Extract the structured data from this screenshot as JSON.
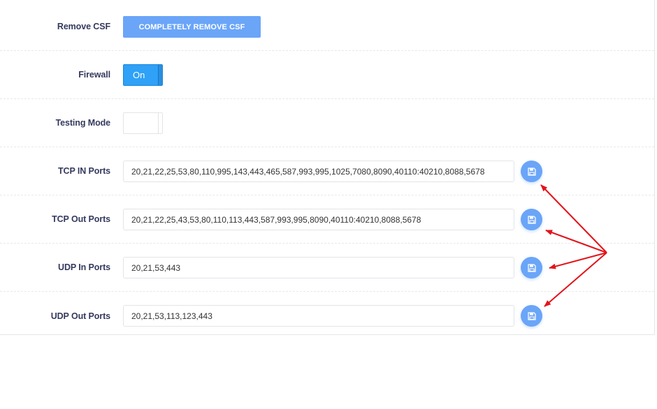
{
  "rows": {
    "remove_csf": {
      "label": "Remove CSF",
      "button_label": "COMPLETELY REMOVE CSF"
    },
    "firewall": {
      "label": "Firewall",
      "toggle_state": "On"
    },
    "testing_mode": {
      "label": "Testing Mode"
    },
    "tcp_in": {
      "label": "TCP IN Ports",
      "value": "20,21,22,25,53,80,110,995,143,443,465,587,993,995,1025,7080,8090,40110:40210,8088,5678"
    },
    "tcp_out": {
      "label": "TCP Out Ports",
      "value": "20,21,22,25,43,53,80,110,113,443,587,993,995,8090,40110:40210,8088,5678"
    },
    "udp_in": {
      "label": "UDP In Ports",
      "value": "20,21,53,443"
    },
    "udp_out": {
      "label": "UDP Out Ports",
      "value": "20,21,53,113,123,443"
    }
  },
  "icons": {
    "save": "save-icon"
  },
  "colors": {
    "primary": "#6aa5f8",
    "toggle_on": "#2fa1f7",
    "annotation_arrow": "#e3141b",
    "label_text": "#34395e"
  }
}
